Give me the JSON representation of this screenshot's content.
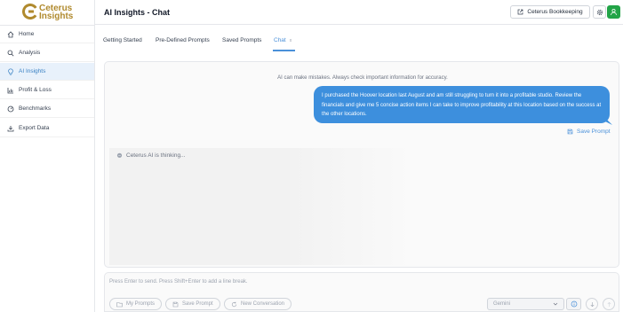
{
  "brand": {
    "line1": "Ceterus",
    "line2": "Insights",
    "color": "#b08a2e"
  },
  "sidebar": {
    "items": [
      {
        "label": "Home",
        "icon": "home-icon"
      },
      {
        "label": "Analysis",
        "icon": "search-icon"
      },
      {
        "label": "AI Insights",
        "icon": "lightbulb-icon",
        "active": true
      },
      {
        "label": "Profit & Loss",
        "icon": "bar-chart-icon"
      },
      {
        "label": "Benchmarks",
        "icon": "gauge-icon"
      },
      {
        "label": "Export Data",
        "icon": "download-icon"
      }
    ]
  },
  "header": {
    "title": "AI Insights - Chat",
    "bookkeeping_label": "Ceterus Bookkeeping",
    "accent": "#22a447"
  },
  "tabs": [
    {
      "label": "Getting Started"
    },
    {
      "label": "Pre-Defined Prompts"
    },
    {
      "label": "Saved Prompts"
    },
    {
      "label": "Chat",
      "active": true,
      "close": "x"
    }
  ],
  "chat": {
    "disclaimer": "AI can make mistakes. Always check important information for accuracy.",
    "user_message": "I purchased the Hoover location last August and am still struggling to turn it into a profitable studio. Review the financials and give me 5 concise action items I can take to improve profitability at this location based on the success at the other locations.",
    "save_prompt_label": "Save Prompt",
    "thinking_label": "Ceterus AI is thinking...",
    "bubble_color": "#3d8fdd"
  },
  "composer": {
    "placeholder": "Press Enter to send. Press Shift+Enter to add a line break.",
    "my_prompts_label": "My Prompts",
    "save_prompt_label": "Save Prompt",
    "new_conversation_label": "New Conversation",
    "model": "Gemini"
  }
}
